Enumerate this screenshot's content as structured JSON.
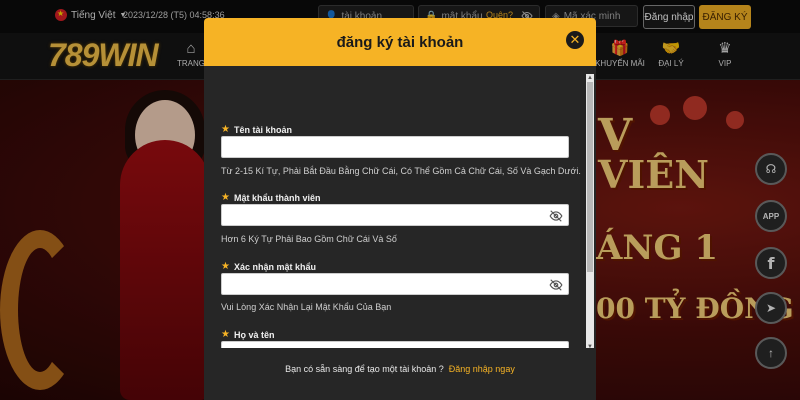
{
  "topbar": {
    "language": "Tiếng Việt",
    "datetime": "2023/12/28 (T5) 04:58:36",
    "username_placeholder": "tài khoản",
    "password_placeholder": "mật khẩu",
    "forgot_label": "Quên?",
    "captcha_placeholder": "Mã xác minh",
    "login_label": "Đăng nhập",
    "register_label": "ĐĂNG KÝ"
  },
  "nav": {
    "logo": "789WIN",
    "items": [
      {
        "label": "TRANG",
        "icon": "home-icon"
      },
      {
        "label": "KHUYẾN MÃI",
        "icon": "gift-icon"
      },
      {
        "label": "ĐẠI LÝ",
        "icon": "handshake-icon"
      },
      {
        "label": "VIP",
        "icon": "crown-icon"
      }
    ]
  },
  "banner": {
    "line1": "V",
    "line2": "VIÊN",
    "line3": "ÁNG 1",
    "amount": "00 TỶ ĐỒNG"
  },
  "side_buttons": {
    "app_label": "APP"
  },
  "modal": {
    "title": "đăng ký tài khoản",
    "fields": [
      {
        "label": "Tên tài khoản",
        "hint": "Từ 2-15 Kí Tự, Phải Bắt Đầu Bằng Chữ Cái, Có Thể Gồm Cả Chữ Cái, Số Và Gạch Dưới."
      },
      {
        "label": "Mật khẩu thành viên",
        "hint": "Hơn 6 Ký Tự Phải Bao Gồm Chữ Cái Và Số"
      },
      {
        "label": "Xác nhận mật khẩu",
        "hint": "Vui Lòng Xác Nhận Lại Mật Khẩu Của Bạn"
      },
      {
        "label": "Họ và tên",
        "hint": ""
      }
    ],
    "footer_text": "Bạn có sẵn sàng để tạo một tài khoản ?",
    "footer_link": "Đăng nhập ngay"
  },
  "colors": {
    "accent": "#f6b325",
    "modal_bg": "#262626",
    "topbar_bg": "#0b0b0b"
  }
}
